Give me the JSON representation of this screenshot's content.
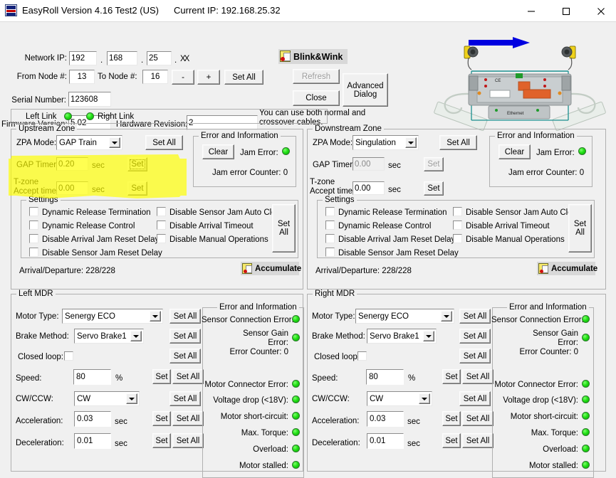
{
  "window": {
    "title": "EasyRoll Version 4.16 Test2 (US)",
    "current_ip": "Current IP: 192.168.25.32",
    "icon": "easyroll-app-icon",
    "minimize": "minimize-icon",
    "maximize": "maximize-icon",
    "close": "close-icon"
  },
  "header": {
    "network_ip_label": "Network IP:",
    "ip_octet1": "192",
    "ip_octet2": "168",
    "ip_octet3": "25",
    "ip_octet4": "XX",
    "dot": ".",
    "from_node_label": "From Node #:",
    "from_node": "13",
    "to_node_label": "To Node #:",
    "to_node": "16",
    "minus": "-",
    "plus": "+",
    "set_all": "Set All",
    "serial_label": "Serial Number:",
    "serial": "123608",
    "firmware_label": "Firmware Version:",
    "firmware": "5.02",
    "hardware_label": "Hardware Revision:",
    "hardware": "2",
    "blink_wink": "Blink&Wink",
    "refresh": "Refresh",
    "close": "Close",
    "advanced_dialog": "Advanced\nDialog",
    "cable_note_line1": "You can use both normal and",
    "cable_note_line2": "crossover cables.",
    "left_link": "Left Link",
    "right_link": "Right Link"
  },
  "upstream": {
    "title": "Upstream Zone",
    "zpa_mode_label": "ZPA Mode:",
    "zpa_mode": "GAP Train",
    "zpa_set_all": "Set All",
    "gap_timer_label": "GAP Timer:",
    "gap_timer": "0.20",
    "sec": "sec",
    "gap_set": "Set",
    "tzone_label_line1": "T-zone",
    "tzone_label_line2": "Accept time:",
    "tzone_value": "0.00",
    "tzone_set": "Set",
    "error_title": "Error and Information",
    "clear": "Clear",
    "jam_error_label": "Jam Error:",
    "jam_error_counter": "Jam error Counter: 0",
    "settings_title": "Settings",
    "checkboxes_left": [
      "Dynamic Release Termination",
      "Dynamic Release Control",
      "Disable Arrival Jam Reset Delay",
      "Disable Sensor Jam Reset Delay"
    ],
    "checkboxes_right": [
      "Disable Sensor Jam Auto Clear",
      "Disable Arrival Timeout",
      "Disable Manual Operations"
    ],
    "settings_set_all": "Set All",
    "arrival_departure": "Arrival/Departure: 228/228",
    "accumulate": "Accumulate"
  },
  "downstream": {
    "title": "Downstream Zone",
    "zpa_mode_label": "ZPA Mode:",
    "zpa_mode": "Singulation",
    "zpa_set_all": "Set All",
    "gap_timer_label": "GAP Timer:",
    "gap_timer": "0.00",
    "sec": "sec",
    "gap_set": "Set",
    "tzone_label_line1": "T-zone",
    "tzone_label_line2": "Accept time:",
    "tzone_value": "0.00",
    "tzone_set": "Set",
    "error_title": "Error and Information",
    "clear": "Clear",
    "jam_error_label": "Jam Error:",
    "jam_error_counter": "Jam error Counter: 0",
    "settings_title": "Settings",
    "checkboxes_left": [
      "Dynamic Release Termination",
      "Dynamic Release Control",
      "Disable Arrival Jam Reset Delay",
      "Disable Sensor Jam Reset Delay"
    ],
    "checkboxes_right": [
      "Disable Sensor Jam Auto Clear",
      "Disable Arrival Timeout",
      "Disable Manual Operations"
    ],
    "settings_set_all": "Set All",
    "arrival_departure": "Arrival/Departure: 228/228",
    "accumulate": "Accumulate"
  },
  "left_mdr": {
    "title": "Left MDR",
    "motor_type_label": "Motor Type:",
    "motor_type": "Senergy ECO",
    "brake_method_label": "Brake Method:",
    "brake_method": "Servo Brake1",
    "closed_loop_label": "Closed loop:",
    "speed_label": "Speed:",
    "speed": "80",
    "percent": "%",
    "cwccw_label": "CW/CCW:",
    "cwccw": "CW",
    "accel_label": "Acceleration:",
    "accel": "0.03",
    "decel_label": "Deceleration:",
    "decel": "0.01",
    "sec": "sec",
    "set": "Set",
    "set_all": "Set All",
    "error_title": "Error and Information",
    "errors": [
      {
        "label": "Sensor Connection Error:",
        "status": "ok"
      },
      {
        "label": "Sensor Gain",
        "label2": "Error:",
        "status": "ok"
      },
      {
        "label": "Error Counter: 0",
        "status": "none"
      },
      {
        "label": "Motor Connector Error:",
        "status": "ok"
      },
      {
        "label": "Voltage drop (<18V):",
        "status": "ok"
      },
      {
        "label": "Motor short-circuit:",
        "status": "ok"
      },
      {
        "label": "Max. Torque:",
        "status": "ok"
      },
      {
        "label": "Overload:",
        "status": "ok"
      },
      {
        "label": "Motor stalled:",
        "status": "ok"
      }
    ]
  },
  "right_mdr": {
    "title": "Right MDR",
    "motor_type_label": "Motor Type:",
    "motor_type": "Senergy ECO",
    "brake_method_label": "Brake Method:",
    "brake_method": "Servo Brake1",
    "closed_loop_label": "Closed loop:",
    "speed_label": "Speed:",
    "speed": "80",
    "percent": "%",
    "cwccw_label": "CW/CCW:",
    "cwccw": "CW",
    "accel_label": "Acceleration:",
    "accel": "0.03",
    "decel_label": "Deceleration:",
    "decel": "0.01",
    "sec": "sec",
    "set": "Set",
    "set_all": "Set All",
    "error_title": "Error and Information",
    "errors": [
      {
        "label": "Sensor Connection Error:",
        "status": "ok"
      },
      {
        "label": "Sensor Gain",
        "label2": "Error:",
        "status": "ok"
      },
      {
        "label": "Error Counter: 0",
        "status": "none"
      },
      {
        "label": "Motor Connector Error:",
        "status": "ok"
      },
      {
        "label": "Voltage drop (<18V):",
        "status": "ok"
      },
      {
        "label": "Motor short-circuit:",
        "status": "ok"
      },
      {
        "label": "Max. Torque:",
        "status": "ok"
      },
      {
        "label": "Overload:",
        "status": "ok"
      },
      {
        "label": "Motor stalled:",
        "status": "ok"
      }
    ]
  },
  "annotations": {
    "highlight_color": "#ffff00",
    "arrow_color": "#0000e0"
  }
}
